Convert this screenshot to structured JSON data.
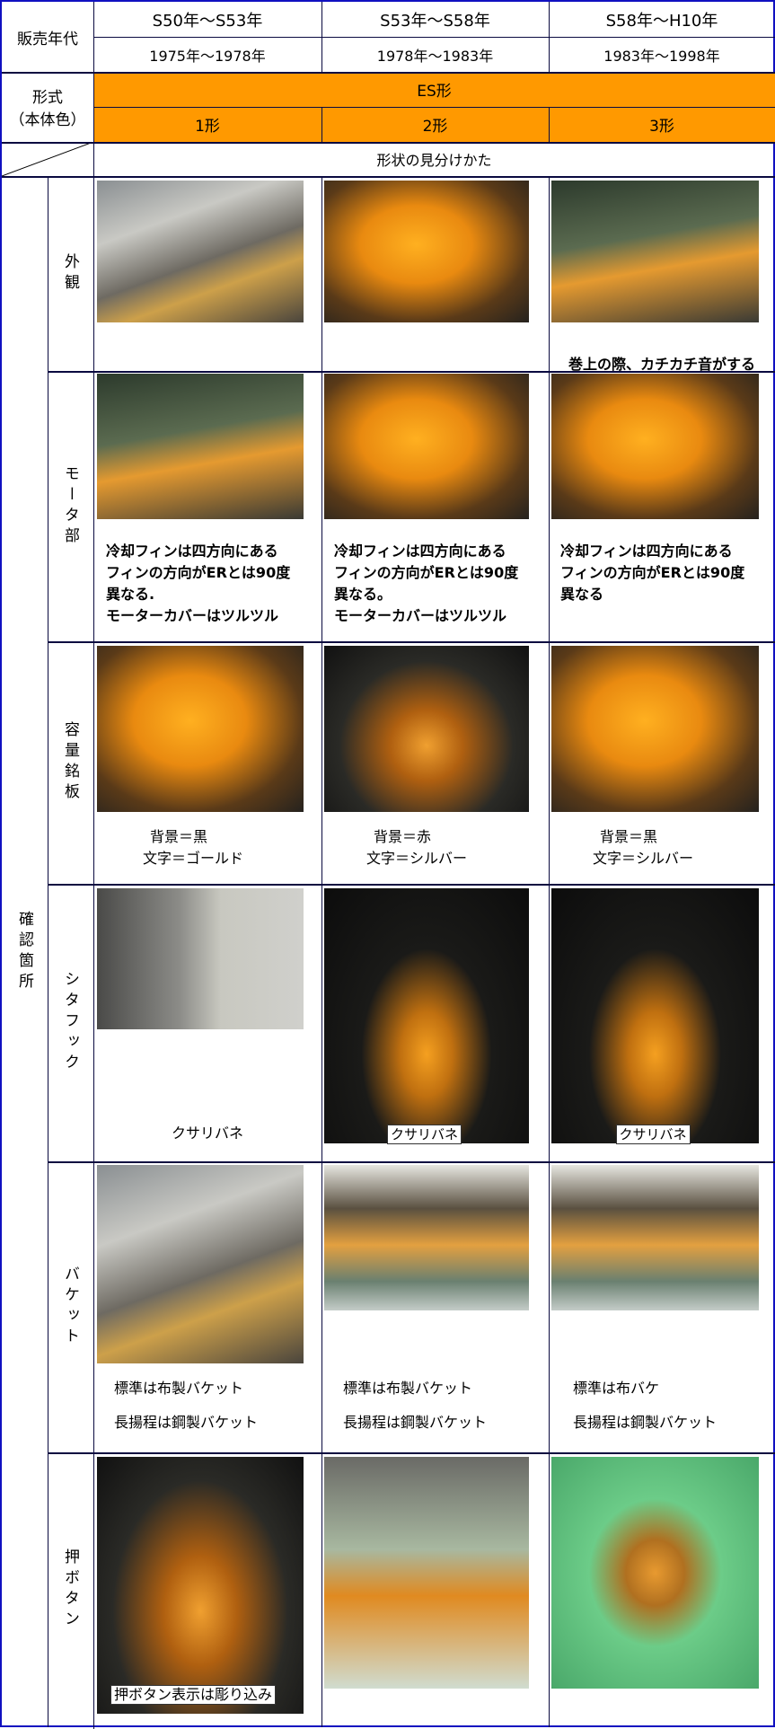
{
  "header": {
    "sales_period_label": "販売年代",
    "model_label_line1": "形式",
    "model_label_line2": "（本体色）",
    "periods": [
      {
        "showa": "S50年～S53年",
        "year": "1975年～1978年"
      },
      {
        "showa": "S53年～S58年",
        "year": "1978年～1983年"
      },
      {
        "showa": "S58年～H10年",
        "year": "1983年～1998年"
      }
    ],
    "model_group": "ES形",
    "models": [
      "1形",
      "2形",
      "3形"
    ],
    "identify_label": "形状の見分けかた",
    "check_points_label": "確認箇所",
    "accent_color": "#ff9900"
  },
  "sections": [
    {
      "label": "外観",
      "cells": [
        {
          "photo": "hoist-exterior",
          "text": []
        },
        {
          "photo": "hoist-exterior",
          "text": []
        },
        {
          "photo": "hoist-exterior",
          "text": [
            "巻上の際、カチカチ音がする"
          ]
        }
      ]
    },
    {
      "label": "モータ部",
      "cells": [
        {
          "photo": "motor",
          "text": [
            "冷却フィンは四方向にある",
            "フィンの方向がERとは90度",
            "異なる.",
            "モーターカバーはツルツル"
          ]
        },
        {
          "photo": "motor",
          "text": [
            "冷却フィンは四方向にある",
            "フィンの方向がERとは90度",
            "異なる。",
            "モーターカバーはツルツル"
          ]
        },
        {
          "photo": "motor",
          "text": [
            "冷却フィンは四方向にある",
            "フィンの方向がERとは90度",
            "異なる"
          ]
        }
      ]
    },
    {
      "label": "容量銘板",
      "cells": [
        {
          "photo": "capacity-plate",
          "text": [
            "背景＝黒",
            "文字＝ゴールド"
          ]
        },
        {
          "photo": "capacity-plate",
          "text": [
            "背景＝赤",
            "文字＝シルバー"
          ]
        },
        {
          "photo": "capacity-plate",
          "text": [
            "背景＝黒",
            "文字＝シルバー"
          ]
        }
      ]
    },
    {
      "label": "シタフック",
      "cells": [
        {
          "photo": "bottom-hook",
          "text": [
            "クサリバネ"
          ]
        },
        {
          "photo": "bottom-hook",
          "text": [
            "クサリバネ"
          ]
        },
        {
          "photo": "bottom-hook",
          "text": [
            "クサリバネ"
          ]
        }
      ]
    },
    {
      "label": "バケット",
      "cells": [
        {
          "photo": "chain-bucket",
          "text": [
            "標準は布製バケット",
            "長揚程は鋼製バケット"
          ]
        },
        {
          "photo": "chain-bucket",
          "text": [
            "標準は布製バケット",
            "長揚程は鋼製バケット"
          ]
        },
        {
          "photo": "chain-bucket",
          "text": [
            "標準は布バケ",
            "長揚程は鋼製バケット"
          ]
        }
      ]
    },
    {
      "label": "押ボタン",
      "cells": [
        {
          "photo": "pendant-switch",
          "text": [
            "押ボタン表示は彫り込み"
          ]
        },
        {
          "photo": "pendant-switch",
          "text": []
        },
        {
          "photo": "pendant-switch",
          "text": []
        }
      ]
    }
  ]
}
